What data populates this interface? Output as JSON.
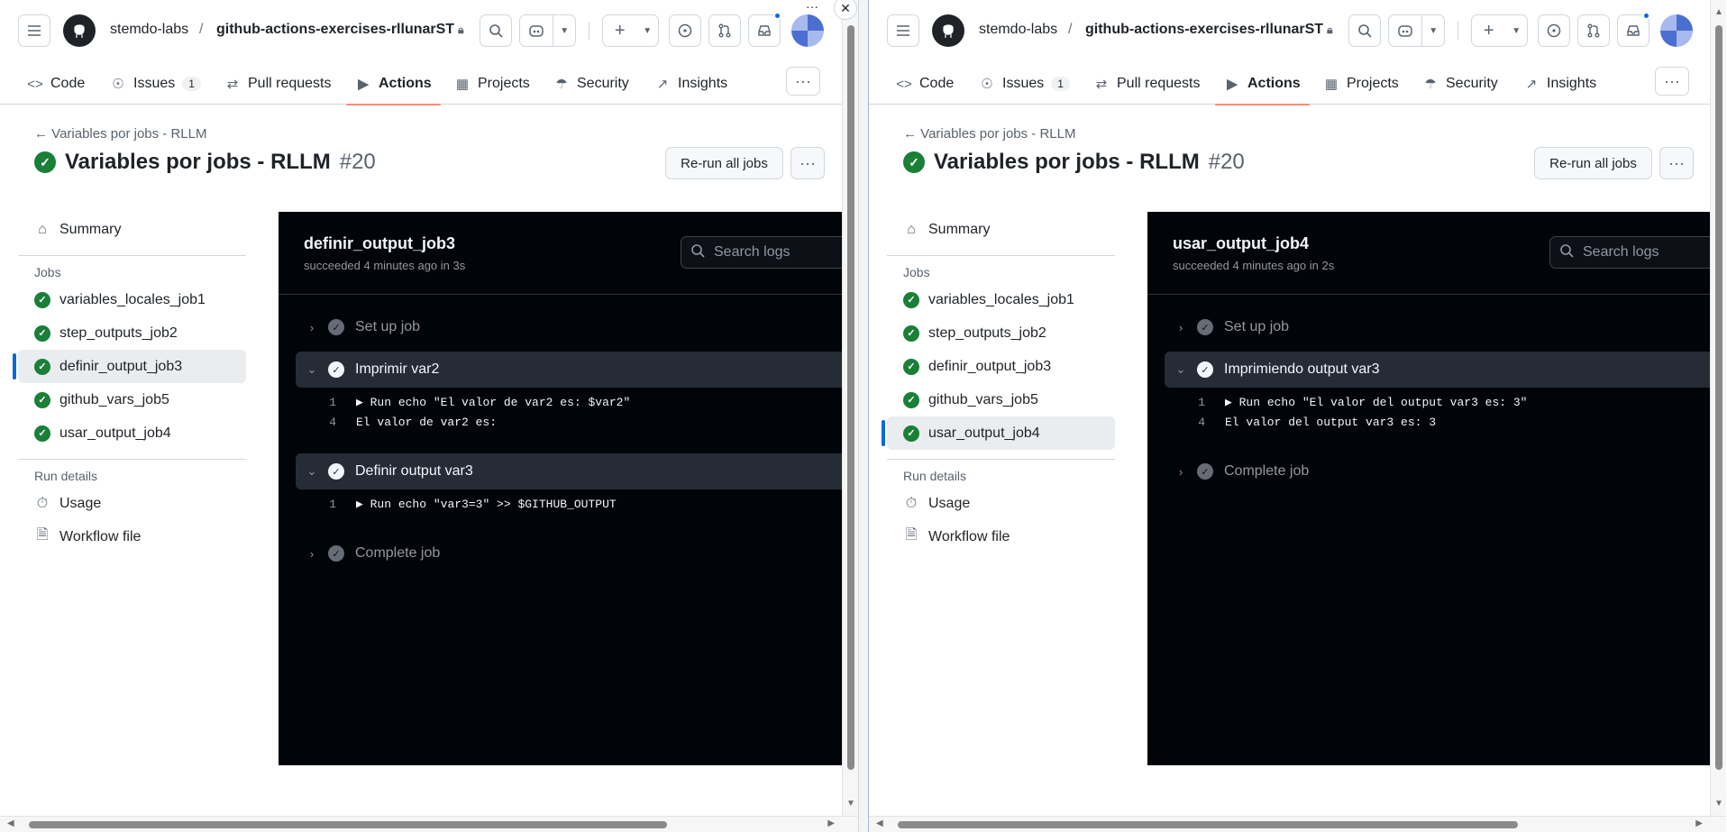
{
  "panes": [
    {
      "owner": "stemdo-labs",
      "repo": "github-actions-exercises-rllunarST",
      "tabs": [
        {
          "label": "Code"
        },
        {
          "label": "Issues",
          "count": "1"
        },
        {
          "label": "Pull requests"
        },
        {
          "label": "Actions"
        },
        {
          "label": "Projects"
        },
        {
          "label": "Security"
        },
        {
          "label": "Insights"
        }
      ],
      "back_label": "Variables por jobs - RLLM",
      "run_title": "Variables por jobs - RLLM",
      "run_number": "#20",
      "rerun_label": "Re-run all jobs",
      "sidebar": {
        "summary": "Summary",
        "jobs_heading": "Jobs",
        "jobs": [
          "variables_locales_job1",
          "step_outputs_job2",
          "definir_output_job3",
          "github_vars_job5",
          "usar_output_job4"
        ],
        "selected_job": "definir_output_job3",
        "run_details_heading": "Run details",
        "usage": "Usage",
        "workflow_file": "Workflow file"
      },
      "log": {
        "job_name": "definir_output_job3",
        "job_meta": "succeeded 4 minutes ago in 3s",
        "search_placeholder": "Search logs",
        "steps": [
          {
            "name": "Set up job",
            "open": false
          },
          {
            "name": "Imprimir var2",
            "open": true,
            "lines": [
              [
                "1",
                "▶ Run echo \"El valor de var2 es: $var2\""
              ],
              [
                "4",
                "El valor de var2 es:"
              ]
            ]
          },
          {
            "name": "Definir output var3",
            "open": true,
            "lines": [
              [
                "1",
                "▶ Run echo \"var3=3\" >> $GITHUB_OUTPUT"
              ]
            ]
          },
          {
            "name": "Complete job",
            "open": false
          }
        ]
      }
    },
    {
      "owner": "stemdo-labs",
      "repo": "github-actions-exercises-rllunarST",
      "tabs": [
        {
          "label": "Code"
        },
        {
          "label": "Issues",
          "count": "1"
        },
        {
          "label": "Pull requests"
        },
        {
          "label": "Actions"
        },
        {
          "label": "Projects"
        },
        {
          "label": "Security"
        },
        {
          "label": "Insights"
        }
      ],
      "back_label": "Variables por jobs - RLLM",
      "run_title": "Variables por jobs - RLLM",
      "run_number": "#20",
      "rerun_label": "Re-run all jobs",
      "sidebar": {
        "summary": "Summary",
        "jobs_heading": "Jobs",
        "jobs": [
          "variables_locales_job1",
          "step_outputs_job2",
          "definir_output_job3",
          "github_vars_job5",
          "usar_output_job4"
        ],
        "selected_job": "usar_output_job4",
        "run_details_heading": "Run details",
        "usage": "Usage",
        "workflow_file": "Workflow file"
      },
      "log": {
        "job_name": "usar_output_job4",
        "job_meta": "succeeded 4 minutes ago in 2s",
        "search_placeholder": "Search logs",
        "steps": [
          {
            "name": "Set up job",
            "open": false
          },
          {
            "name": "Imprimiendo output var3",
            "open": true,
            "lines": [
              [
                "1",
                "▶ Run echo \"El valor del output var3 es: 3\""
              ],
              [
                "4",
                "El valor del output var3 es: 3"
              ]
            ]
          },
          {
            "name": "Complete job",
            "open": false
          }
        ]
      }
    }
  ],
  "window_controls": {
    "more": "···",
    "close": "✕"
  },
  "colors": {
    "accent": "#0969da",
    "success": "#1a7f37",
    "active_tab_underline": "#fd8c73",
    "log_bg": "#010409"
  }
}
